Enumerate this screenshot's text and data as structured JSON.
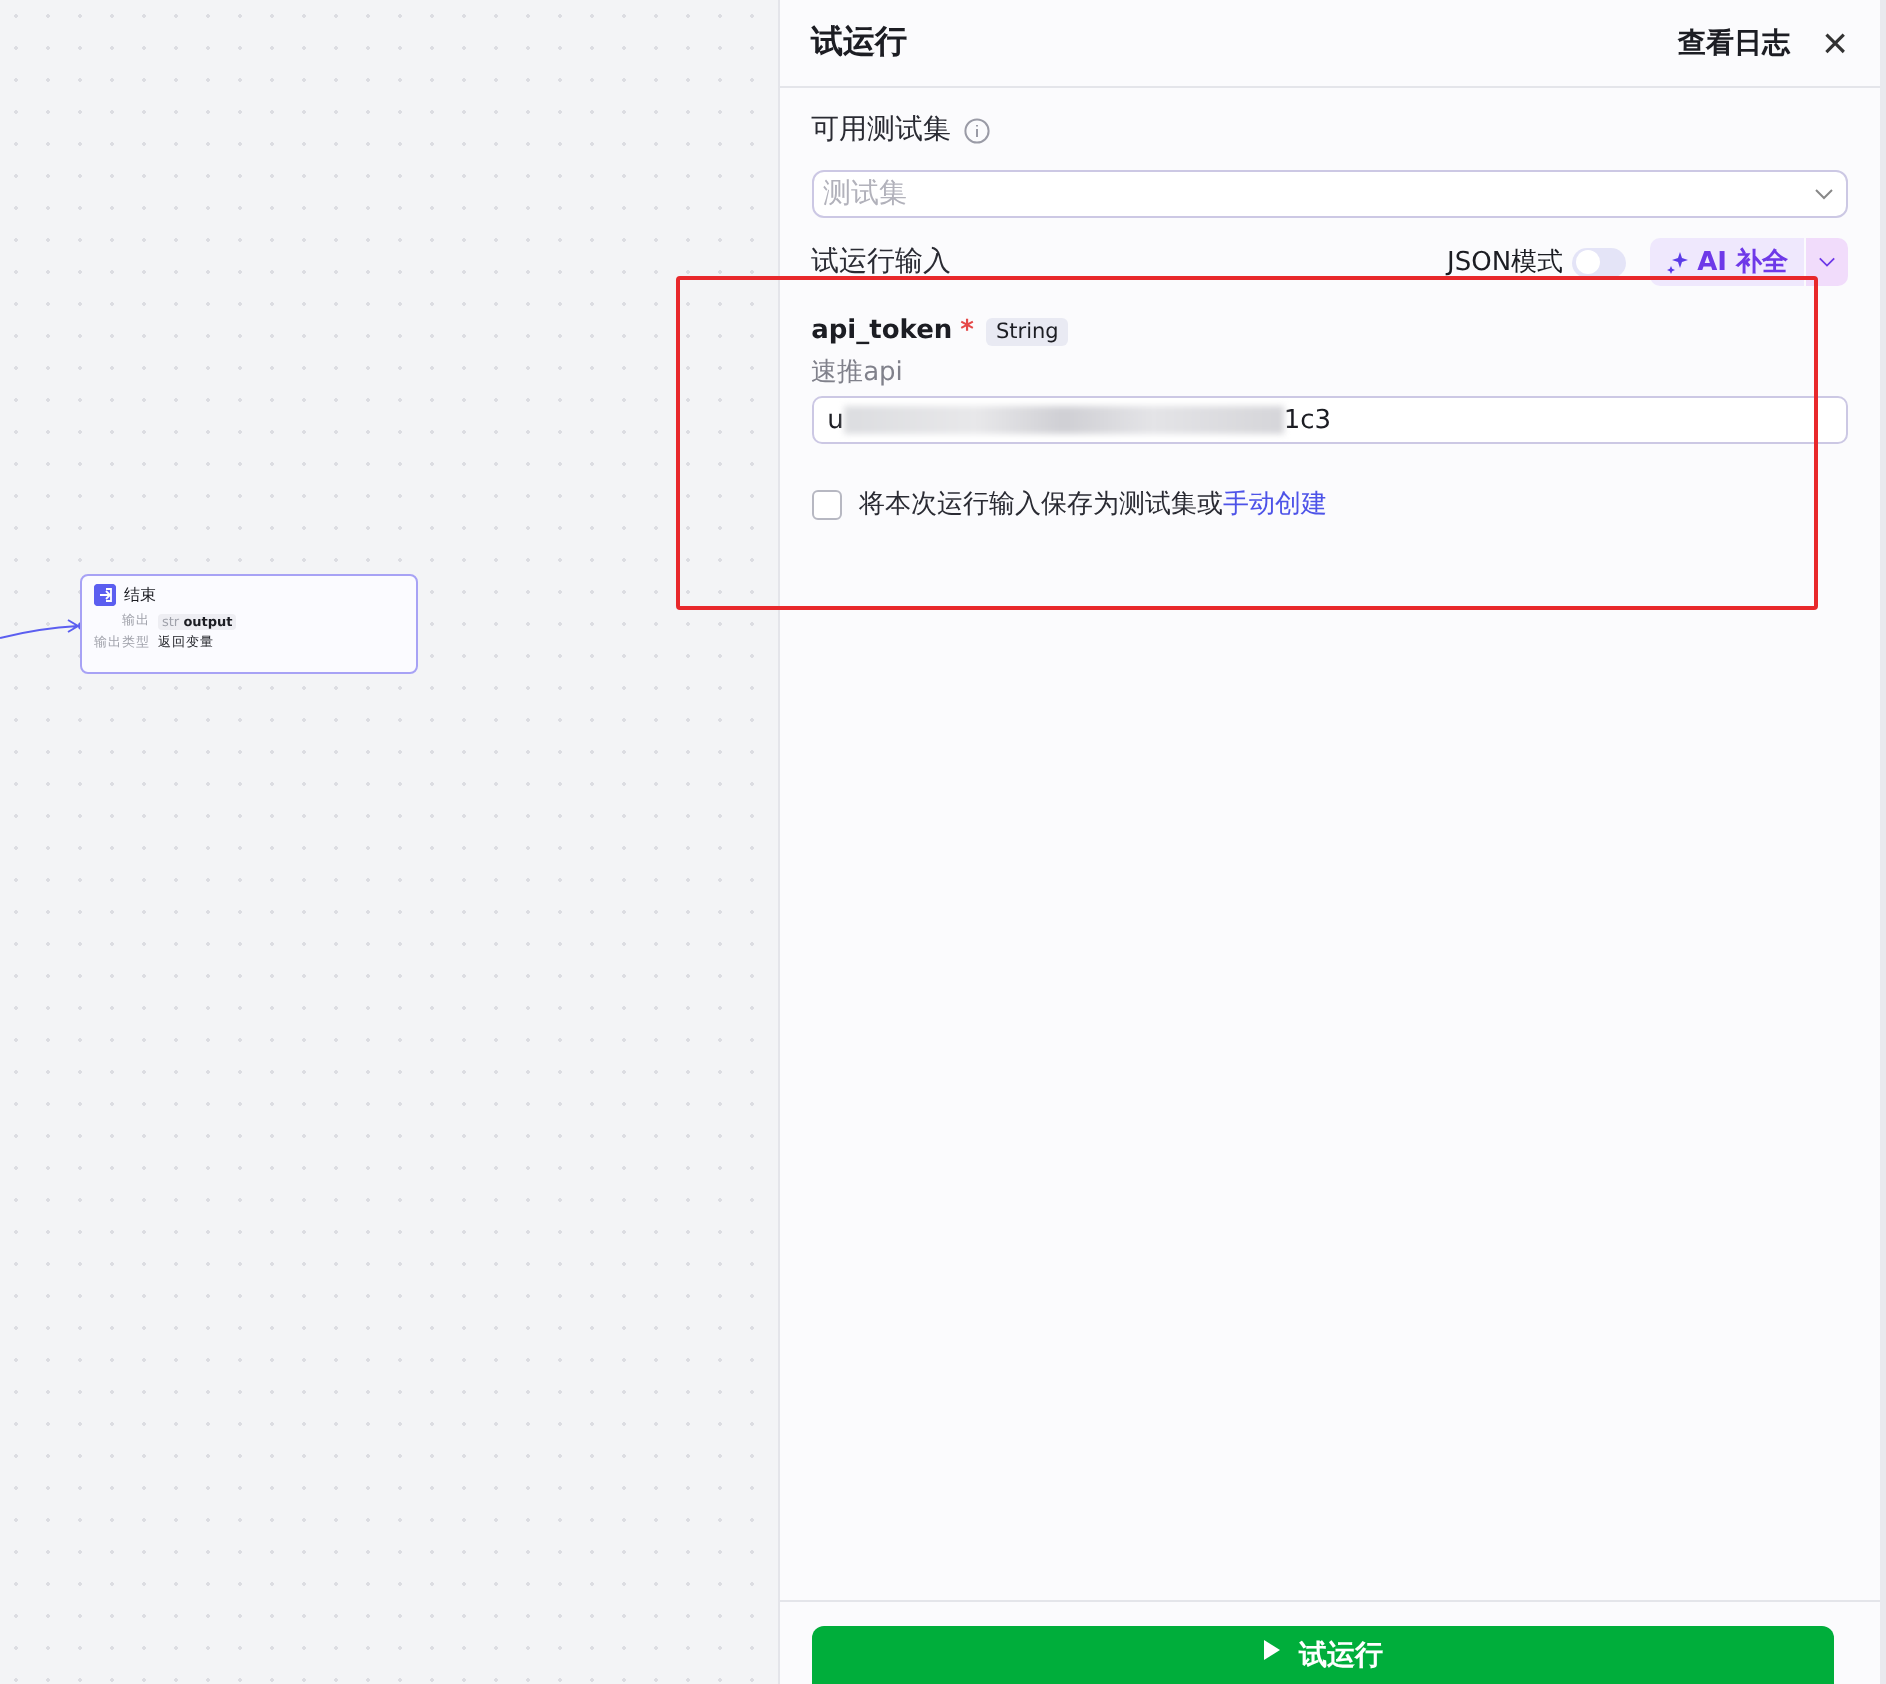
{
  "canvas": {
    "node": {
      "title": "结束",
      "rows": [
        {
          "label": "输出",
          "tag": "str",
          "value": "output"
        },
        {
          "label": "输出类型",
          "value": "返回变量"
        }
      ]
    }
  },
  "panel": {
    "title": "试运行",
    "log_link": "查看日志",
    "close": "×",
    "testset": {
      "label": "可用测试集",
      "placeholder": "测试集"
    },
    "input_section": {
      "title": "试运行输入",
      "json_mode": {
        "label": "JSON模式",
        "on": false
      },
      "ai_button": "AI 补全"
    },
    "param": {
      "name": "api_token",
      "required": true,
      "required_mark": "*",
      "type": "String",
      "description": "速推api",
      "value_start": "u",
      "value_end": "1c3",
      "redacted": true
    },
    "save": {
      "checked": false,
      "text": "将本次运行输入保存为测试集或",
      "link": "手动创建"
    },
    "run_button": "试运行"
  },
  "annotation": {
    "kind": "highlight-box",
    "color": "#e8282b"
  }
}
